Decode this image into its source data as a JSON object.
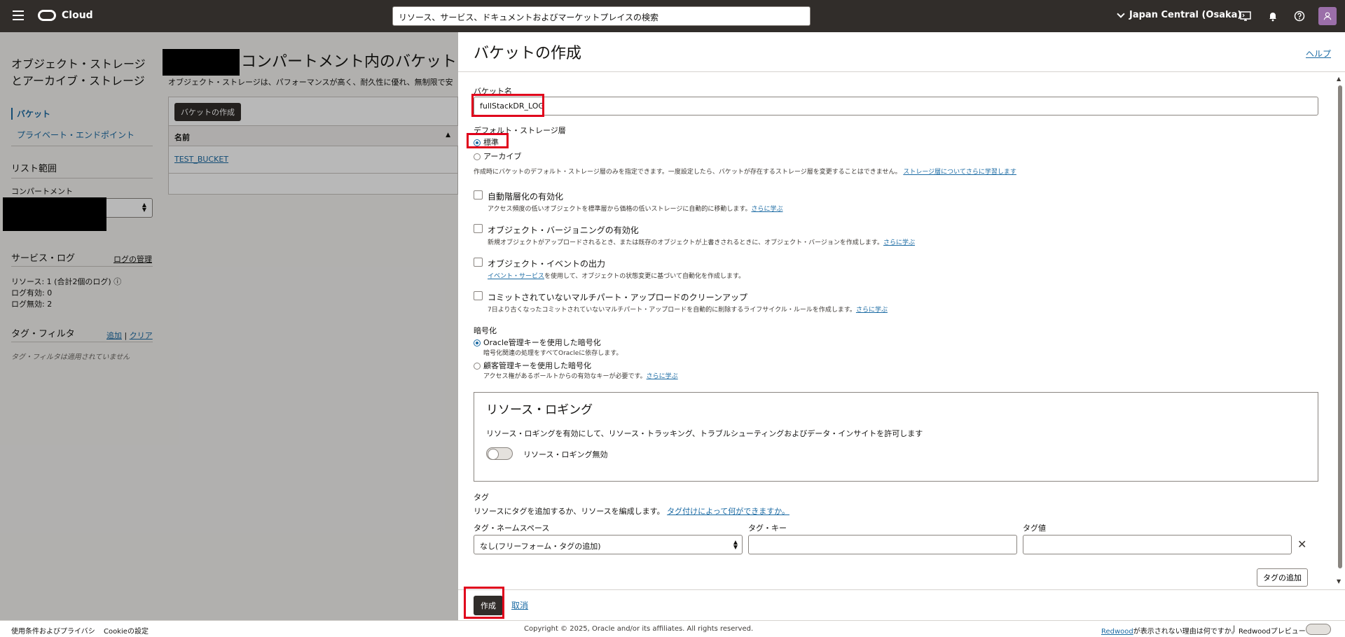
{
  "header": {
    "brand": "Cloud",
    "search_placeholder": "リソース、サービス、ドキュメントおよびマーケットプレイスの検索",
    "region": "Japan Central (Osaka)",
    "icons": [
      "menu-icon",
      "cloud-shell-icon",
      "bell-icon",
      "help-icon",
      "user-icon"
    ]
  },
  "left_nav": {
    "title": "オブジェクト・ストレージとアーカイブ・ストレージ",
    "items": [
      {
        "label": "バケット",
        "active": true
      },
      {
        "label": "プライベート・エンドポイント",
        "active": false
      }
    ],
    "list_scope": "リスト範囲",
    "compartment_label": "コンパートメント",
    "service_logs": "サービス・ログ",
    "manage_logs": "ログの管理",
    "resources": "リソース: 1 (合計2個のログ)",
    "logs_enabled": "ログ有効: 0",
    "logs_disabled": "ログ無効: 2",
    "tag_filter": "タグ・フィルタ",
    "add": "追加",
    "separator": "|",
    "clear": "クリア",
    "no_tag_filter": "タグ・フィルタは適用されていません"
  },
  "bg_main": {
    "heading": "コンパートメント内のバケット",
    "description": "オブジェクト・ストレージは、パフォーマンスが高く、耐久性に優れ、無制限で安",
    "create_bucket_btn": "バケットの作成",
    "col_name": "名前",
    "row_bucket": "TEST_BUCKET"
  },
  "panel": {
    "title": "バケットの作成",
    "help": "ヘルプ",
    "bucket_name_label": "バケット名",
    "bucket_name_value": "fullStackDR_LOG",
    "storage_tier_label": "デフォルト・ストレージ層",
    "tier_standard": "標準",
    "tier_archive": "アーカイブ",
    "tier_hint": "作成時にバケットのデフォルト・ストレージ層のみを指定できます。一度設定したら、バケットが存在するストレージ層を変更することはできません。",
    "tier_hint_link": "ストレージ層についてさらに学習します",
    "options": [
      {
        "title": "自動階層化の有効化",
        "hint": "アクセス頻度の低いオブジェクトを標準層から価格の低いストレージに自動的に移動します。",
        "link": "さらに学ぶ",
        "link_first": false
      },
      {
        "title": "オブジェクト・バージョニングの有効化",
        "hint": "新規オブジェクトがアップロードされるとき、または既存のオブジェクトが上書きされるときに、オブジェクト・バージョンを作成します。",
        "link": "さらに学ぶ",
        "link_first": false
      },
      {
        "title": "オブジェクト・イベントの出力",
        "hint": "を使用して、オブジェクトの状態変更に基づいて自動化を作成します。",
        "link": "イベント・サービス",
        "link_first": true
      },
      {
        "title": "コミットされていないマルチパート・アップロードのクリーンアップ",
        "hint": "7日より古くなったコミットされていないマルチパート・アップロードを自動的に削除するライフサイクル・ルールを作成します。",
        "link": "さらに学ぶ",
        "link_first": false
      }
    ],
    "encryption_label": "暗号化",
    "enc_oracle": "Oracle管理キーを使用した暗号化",
    "enc_oracle_hint": "暗号化関連の処理をすべてOracleに依存します。",
    "enc_customer": "顧客管理キーを使用した暗号化",
    "enc_customer_hint": "アクセス権があるボールトからの有効なキーが必要です。",
    "enc_customer_link": "さらに学ぶ",
    "logging_title": "リソース・ロギング",
    "logging_desc": "リソース・ロギングを有効にして、リソース・トラッキング、トラブルシューティングおよびデータ・インサイトを許可します",
    "logging_toggle_label": "リソース・ロギング無効",
    "tags_label": "タグ",
    "tags_desc": "リソースにタグを追加するか、リソースを編成します。",
    "tags_link": "タグ付けによって何ができますか。",
    "tag_ns_label": "タグ・ネームスペース",
    "tag_ns_value": "なし(フリーフォーム・タグの追加)",
    "tag_key_label": "タグ・キー",
    "tag_value_label": "タグ値",
    "add_tag_btn": "タグの追加",
    "create_btn": "作成",
    "cancel_link": "取消"
  },
  "footer": {
    "terms": "使用条件およびプライバシ",
    "cookies": "Cookieの設定",
    "copyright": "Copyright © 2025, Oracle and/or its affiliates. All rights reserved.",
    "redwood_link": "Redwood",
    "redwood_text": "が表示されない理由は何ですか。",
    "separator": "|",
    "redwood_preview": "Redwoodプレビュー"
  }
}
